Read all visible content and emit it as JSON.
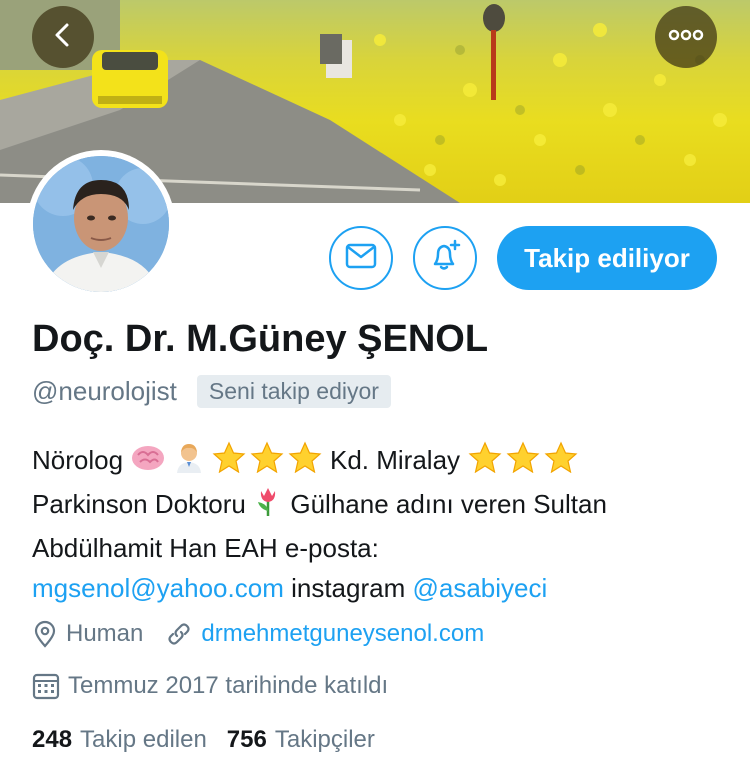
{
  "header": {
    "back_icon": "chevron-left-icon",
    "more_icon": "more-horizontal-icon"
  },
  "actions": {
    "message_icon": "mail-icon",
    "notify_icon": "bell-plus-icon",
    "follow_label": "Takip ediliyor"
  },
  "profile": {
    "display_name": "Doç. Dr. M.Güney ŞENOL",
    "handle": "@neurolojist",
    "follows_you": "Seni takip ediyor",
    "bio": {
      "t1": "Nörolog",
      "t2": "Kd. Miralay",
      "t3": "Parkinson Doktoru",
      "t4": "Gülhane adını veren Sultan Abdülhamit Han EAH e-posta:",
      "email": "mgsenol@yahoo.com",
      "t5": "instagram",
      "instagram": "@asabiyeci"
    },
    "location": "Human",
    "website": "drmehmetguneysenol.com",
    "joined": "Temmuz 2017 tarihinde katıldı"
  },
  "stats": {
    "following_count": "248",
    "following_label": "Takip edilen",
    "followers_count": "756",
    "followers_label": "Takipçiler"
  },
  "colors": {
    "accent": "#1da1f2",
    "secondary_text": "#657786",
    "primary_text": "#14171a"
  }
}
